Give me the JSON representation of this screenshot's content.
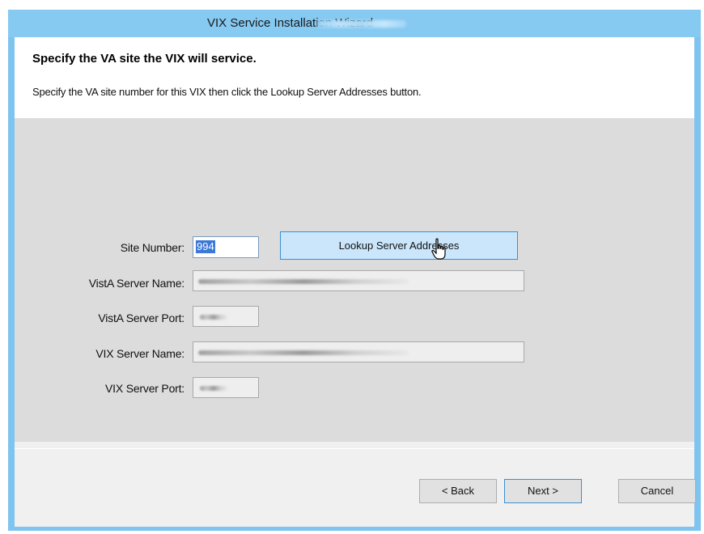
{
  "window": {
    "title": "VIX Service Installation Wizard"
  },
  "header": {
    "title": "Specify the VA site the VIX will service.",
    "description": "Specify the VA site number for this VIX then click the Lookup Server Addresses button."
  },
  "form": {
    "site_number_label": "Site Number:",
    "site_number_value": "994",
    "lookup_button_label": "Lookup Server Addresses",
    "vista_server_name_label": "VistA Server Name:",
    "vista_server_port_label": "VistA Server Port:",
    "vix_server_name_label": "VIX Server Name:",
    "vix_server_port_label": "VIX Server Port:"
  },
  "footer": {
    "back_label": "< Back",
    "next_label": "Next >",
    "cancel_label": "Cancel"
  },
  "colors": {
    "titlebar": "#86c9f1",
    "accent": "#3c8ed3",
    "selection": "#3b78d8"
  },
  "icons": {
    "cursor": "hand-pointer-icon"
  }
}
